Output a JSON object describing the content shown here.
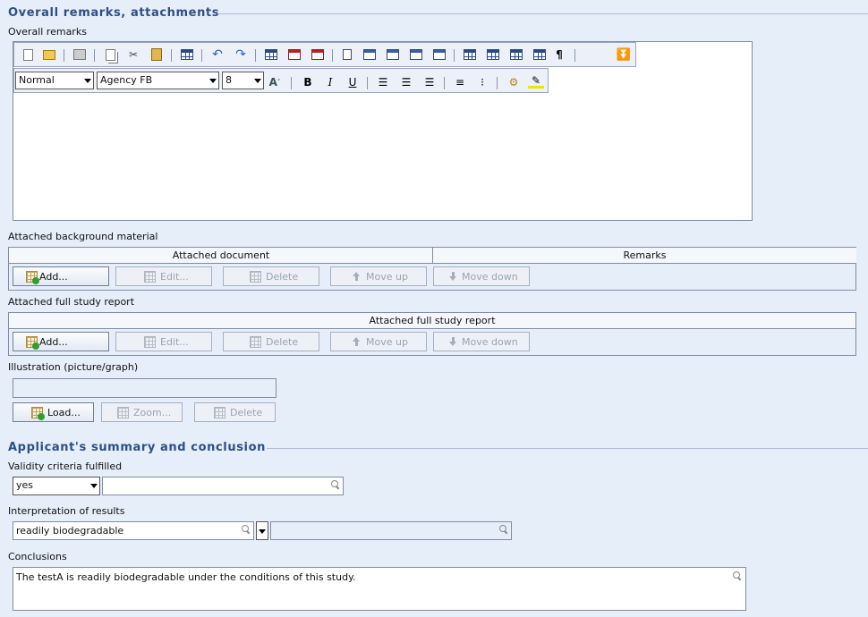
{
  "remarks_section": {
    "title": "Overall remarks, attachments",
    "overall_remarks_label": "Overall remarks",
    "editor": {
      "style_value": "Normal",
      "font_value": "Agency FB",
      "size_value": "8",
      "toolbar1_icons": [
        "new-document-icon",
        "open-folder-icon",
        "print-icon",
        "copy-icon",
        "cut-icon",
        "paste-icon",
        "table-icon",
        "undo-icon",
        "redo-icon",
        "table-icon",
        "table-icon",
        "table-icon",
        "insert-column-icon",
        "table-icon",
        "table-icon",
        "table-icon",
        "table-icon",
        "table-grid-icon",
        "table-grid-icon",
        "table-grid-icon",
        "table-grid-icon",
        "pilcrow-icon",
        "expand-down-icon"
      ],
      "toolbar2_icons": [
        "font-size-icon",
        "bold-icon",
        "italic-icon",
        "underline-icon",
        "align-left-icon",
        "align-center-icon",
        "align-right-icon",
        "numbered-list-icon",
        "bullet-list-icon",
        "spell-check-icon",
        "highlight-icon"
      ],
      "content": ""
    },
    "background_material": {
      "label": "Attached background material",
      "columns": [
        "Attached document",
        "Remarks"
      ],
      "buttons": {
        "add": "Add...",
        "edit": "Edit...",
        "delete": "Delete",
        "move_up": "Move up",
        "move_down": "Move down"
      }
    },
    "full_study_report": {
      "label": "Attached full study report",
      "columns": [
        "Attached full study report"
      ],
      "buttons": {
        "add": "Add...",
        "edit": "Edit...",
        "delete": "Delete",
        "move_up": "Move up",
        "move_down": "Move down"
      }
    },
    "illustration": {
      "label": "Illustration (picture/graph)",
      "value": "",
      "buttons": {
        "load": "Load...",
        "zoom": "Zoom...",
        "delete": "Delete"
      }
    }
  },
  "summary_section": {
    "title": "Applicant's summary and conclusion",
    "validity": {
      "label": "Validity criteria fulfilled",
      "select_value": "yes",
      "remark": ""
    },
    "interpretation": {
      "label": "Interpretation of results",
      "value": "readily biodegradable",
      "other": ""
    },
    "conclusions": {
      "label": "Conclusions",
      "value": "The testA is readily biodegradable under the conditions of this study."
    }
  }
}
